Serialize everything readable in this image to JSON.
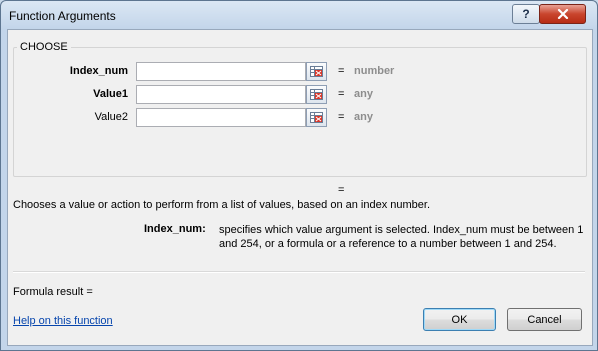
{
  "window": {
    "title": "Function Arguments",
    "help_button": "?",
    "close_button": "x"
  },
  "function": {
    "name": "CHOOSE",
    "arguments": [
      {
        "label": "Index_num",
        "bold": true,
        "value": "",
        "result": "number"
      },
      {
        "label": "Value1",
        "bold": true,
        "value": "",
        "result": "any"
      },
      {
        "label": "Value2",
        "bold": false,
        "value": "",
        "result": "any"
      }
    ],
    "equals": "=",
    "result_equals": "=",
    "description": "Chooses a value or action to perform from a list of values, based on an index number.",
    "arg_help_name": "Index_num:",
    "arg_help_text": "specifies which value argument is selected. Index_num must be between 1 and 254, or a formula or a reference to a number between 1 and 254."
  },
  "footer": {
    "formula_result_label": "Formula result =",
    "help_link": "Help on this function",
    "ok_label": "OK",
    "cancel_label": "Cancel"
  },
  "icons": {
    "ref_button": "collapse-dialog-icon"
  }
}
